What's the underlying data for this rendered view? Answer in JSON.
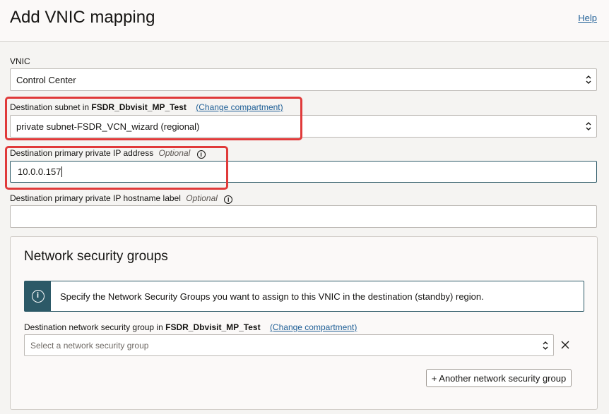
{
  "header": {
    "title": "Add VNIC mapping",
    "help_label": "Help"
  },
  "vnic": {
    "label": "VNIC",
    "value": "Control Center"
  },
  "dest_subnet": {
    "label_prefix": "Destination subnet in",
    "compartment": "FSDR_Dbvisit_MP_Test",
    "change_link": "(Change compartment)",
    "value": "private subnet-FSDR_VCN_wizard (regional)"
  },
  "dest_ip": {
    "label": "Destination primary private IP address",
    "optional": "Optional",
    "info_icon": "i",
    "value": "10.0.0.157"
  },
  "dest_hostname": {
    "label": "Destination primary private IP hostname label",
    "optional": "Optional",
    "info_icon": "i",
    "value": ""
  },
  "nsg": {
    "title": "Network security groups",
    "banner_icon": "i",
    "banner_text": "Specify the Network Security Groups you want to assign to this VNIC in the destination (standby) region.",
    "field_label_prefix": "Destination network security group in",
    "compartment": "FSDR_Dbvisit_MP_Test",
    "change_link": "(Change compartment)",
    "select_placeholder": "Select a network security group",
    "add_button": "+ Another network security group"
  },
  "colors": {
    "highlight_box": "#e03a3a",
    "link": "#1f5f96",
    "banner_accent": "#2c5967"
  }
}
